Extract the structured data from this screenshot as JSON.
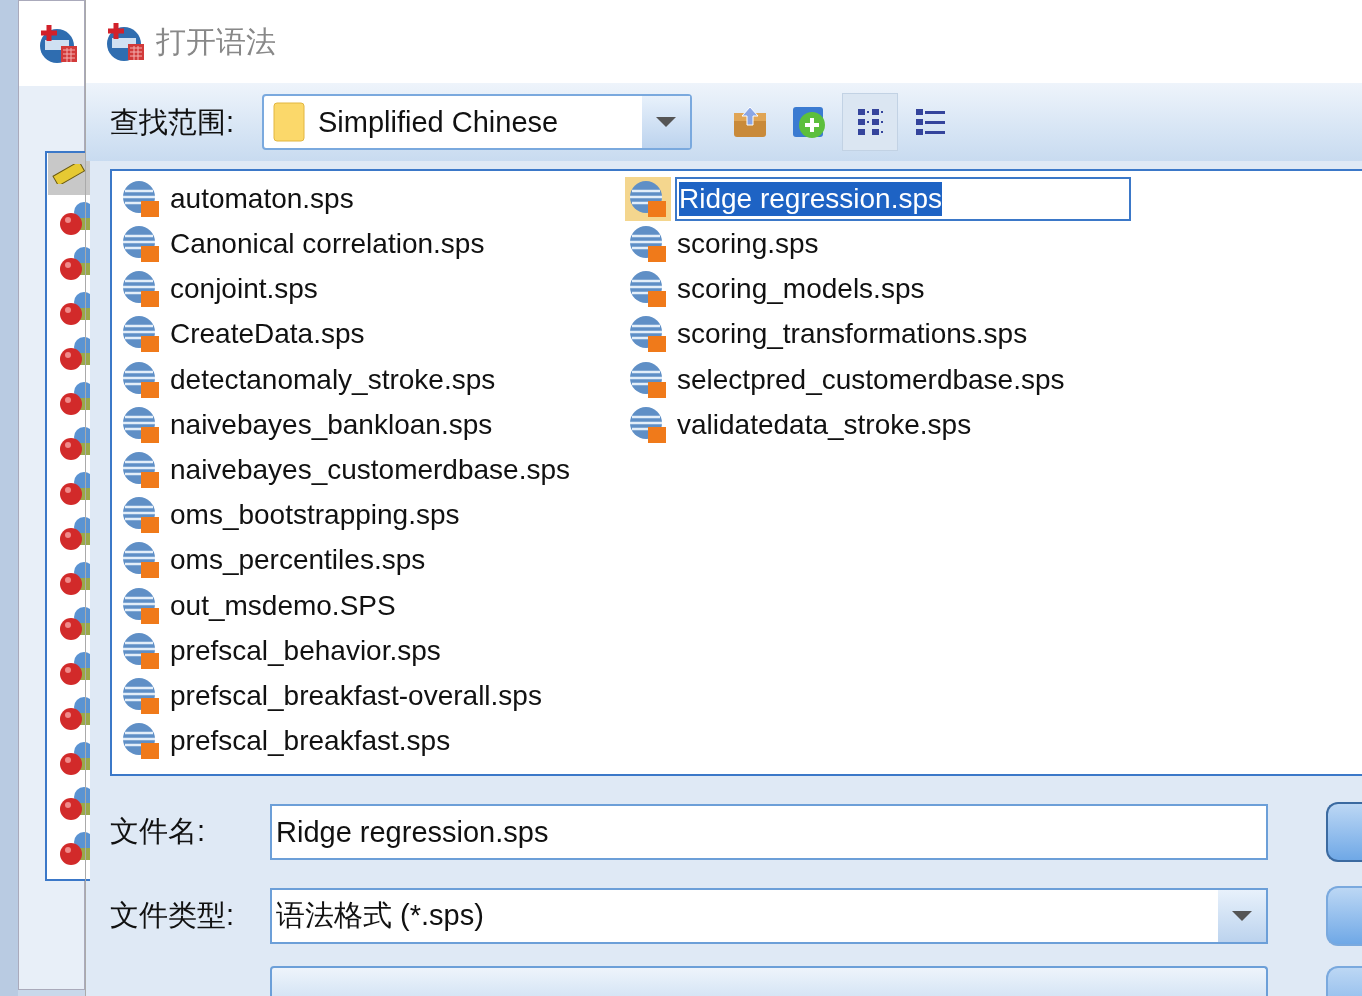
{
  "window": {
    "title": "打开语法"
  },
  "look_in": {
    "label": "查找范围:",
    "value": "Simplified Chinese"
  },
  "toolbar": [
    {
      "kind": "up",
      "selected": false
    },
    {
      "kind": "new-folder",
      "selected": false
    },
    {
      "kind": "list",
      "selected": true
    },
    {
      "kind": "details",
      "selected": false
    }
  ],
  "files": [
    {
      "name": "automaton.sps",
      "selected": false
    },
    {
      "name": "Canonical correlation.sps",
      "selected": false
    },
    {
      "name": "conjoint.sps",
      "selected": false
    },
    {
      "name": "CreateData.sps",
      "selected": false
    },
    {
      "name": "detectanomaly_stroke.sps",
      "selected": false
    },
    {
      "name": "naivebayes_bankloan.sps",
      "selected": false
    },
    {
      "name": "naivebayes_customerdbase.sps",
      "selected": false
    },
    {
      "name": "oms_bootstrapping.sps",
      "selected": false
    },
    {
      "name": "oms_percentiles.sps",
      "selected": false
    },
    {
      "name": "out_msdemo.SPS",
      "selected": false
    },
    {
      "name": "prefscal_behavior.sps",
      "selected": false
    },
    {
      "name": "prefscal_breakfast-overall.sps",
      "selected": false
    },
    {
      "name": "prefscal_breakfast.sps",
      "selected": false
    },
    {
      "name": "Ridge regression.sps",
      "selected": true
    },
    {
      "name": "scoring.sps",
      "selected": false
    },
    {
      "name": "scoring_models.sps",
      "selected": false
    },
    {
      "name": "scoring_transformations.sps",
      "selected": false
    },
    {
      "name": "selectpred_customerdbase.sps",
      "selected": false
    },
    {
      "name": "validatedata_stroke.sps",
      "selected": false
    }
  ],
  "file_name": {
    "label": "文件名:",
    "value": "Ridge regression.sps"
  },
  "file_type": {
    "label": "文件类型:",
    "value": "语法格式 (*.sps)"
  }
}
